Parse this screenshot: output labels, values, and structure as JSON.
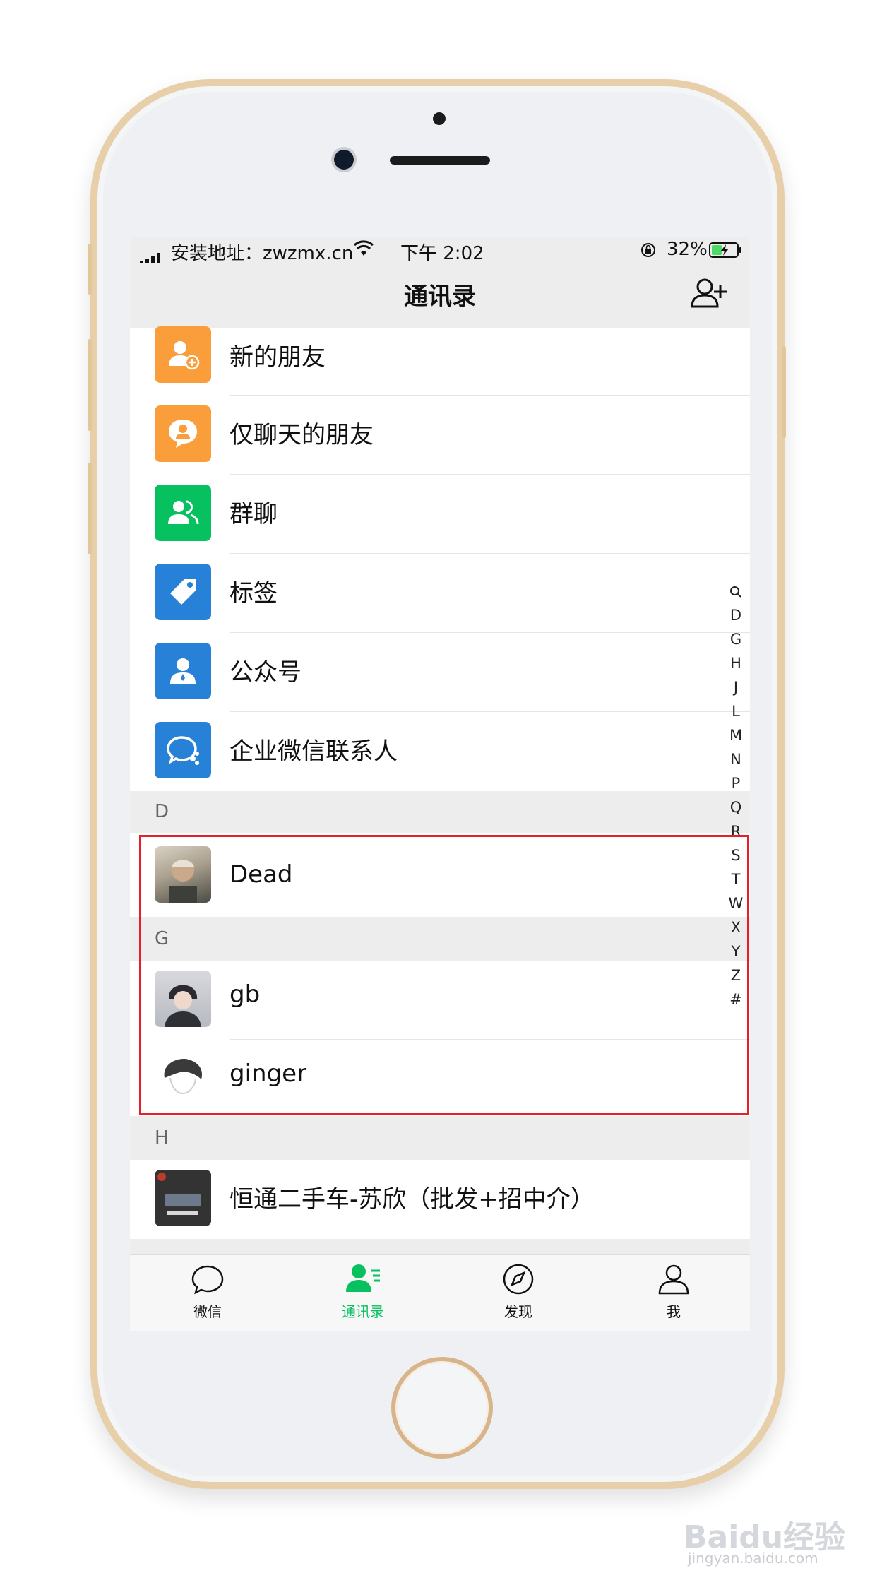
{
  "status_bar": {
    "carrier": "安装地址：zwzmx.cn",
    "time": "下午 2:02",
    "battery": "32%"
  },
  "nav": {
    "title": "通讯录"
  },
  "menu_items": [
    {
      "label": "新的朋友",
      "color": "#fa9d3b",
      "icon": "new-friend-icon"
    },
    {
      "label": "仅聊天的朋友",
      "color": "#fa9d3b",
      "icon": "chat-only-icon"
    },
    {
      "label": "群聊",
      "color": "#07c160",
      "icon": "group-chat-icon"
    },
    {
      "label": "标签",
      "color": "#2782d7",
      "icon": "tag-icon"
    },
    {
      "label": "公众号",
      "color": "#2782d7",
      "icon": "official-account-icon"
    },
    {
      "label": "企业微信联系人",
      "color": "#2782d7",
      "icon": "work-contacts-icon"
    }
  ],
  "contacts": [
    {
      "section": "D",
      "names": [
        "Dead"
      ]
    },
    {
      "section": "G",
      "names": [
        "gb",
        "ginger"
      ]
    },
    {
      "section": "H",
      "names": [
        "恒通二手车-苏欣（批发+招中介）"
      ]
    }
  ],
  "index_letters": [
    "D",
    "G",
    "H",
    "J",
    "L",
    "M",
    "N",
    "P",
    "Q",
    "R",
    "S",
    "T",
    "W",
    "X",
    "Y",
    "Z",
    "#"
  ],
  "tabs": [
    {
      "label": "微信",
      "icon": "chat-bubble-icon",
      "active": false
    },
    {
      "label": "通讯录",
      "icon": "contacts-icon",
      "active": true
    },
    {
      "label": "发现",
      "icon": "compass-icon",
      "active": false
    },
    {
      "label": "我",
      "icon": "person-icon",
      "active": false
    }
  ],
  "colors": {
    "accent": "#07c160",
    "highlight": "#e61e2a",
    "phone_frame": "#e6cfa9"
  },
  "watermark": {
    "brand": "Baidu经验",
    "url": "jingyan.baidu.com"
  }
}
